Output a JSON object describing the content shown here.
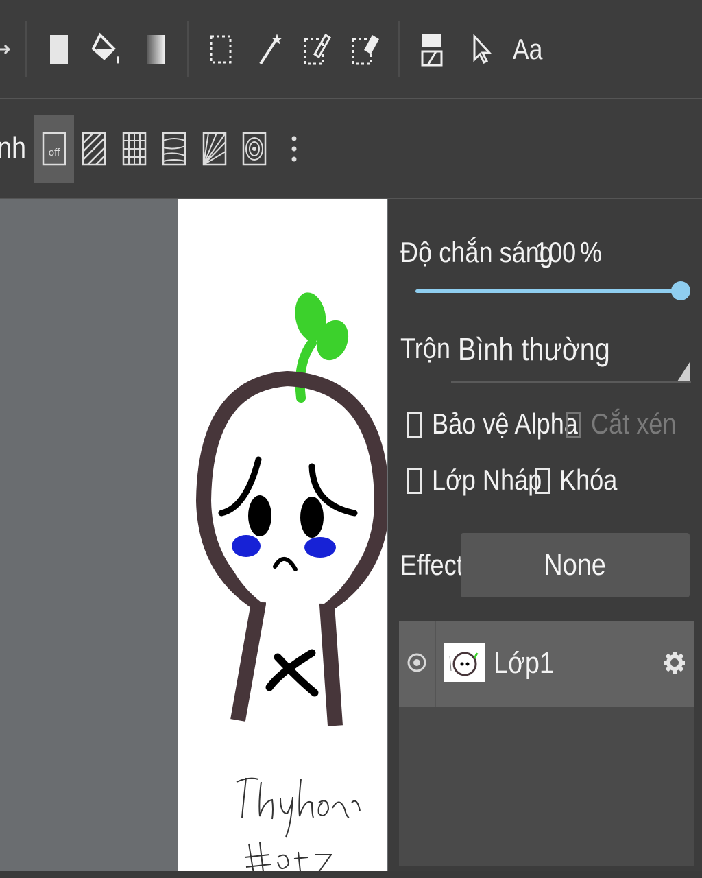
{
  "toolbar": {
    "tools": [
      {
        "name": "fill-color-icon"
      },
      {
        "name": "bucket-fill-icon"
      },
      {
        "name": "gradient-icon"
      },
      {
        "name": "select-rect-icon"
      },
      {
        "name": "magic-wand-icon"
      },
      {
        "name": "select-pen-icon"
      },
      {
        "name": "select-eraser-icon"
      },
      {
        "name": "transform-icon"
      },
      {
        "name": "pointer-icon"
      },
      {
        "name": "text-tool-icon",
        "label": "Aa"
      }
    ]
  },
  "tone_bar": {
    "left_partial_label": "nh",
    "off_label": "off",
    "more_icon": "more-vertical-icon"
  },
  "canvas": {
    "signature": "Thuyhoamer #hot Zer"
  },
  "layer_panel": {
    "opacity_label": "Độ chắn sáng",
    "opacity_value": "100",
    "opacity_unit": "%",
    "opacity_fraction": 1.0,
    "blend_label": "Trộn",
    "blend_value": "Bình thường",
    "protect_alpha_label": "Bảo vệ Alpha",
    "clipping_label": "Cắt xén",
    "draft_layer_label": "Lớp Nháp",
    "lock_label": "Khóa",
    "effect_label": "Effect",
    "effect_value": "None",
    "layers": [
      {
        "name": "Lớp1",
        "visible": true
      }
    ]
  },
  "colors": {
    "accent": "#8fcef0",
    "panel_bg": "#3c3c3c",
    "canvas_bg": "#6a6d70"
  }
}
